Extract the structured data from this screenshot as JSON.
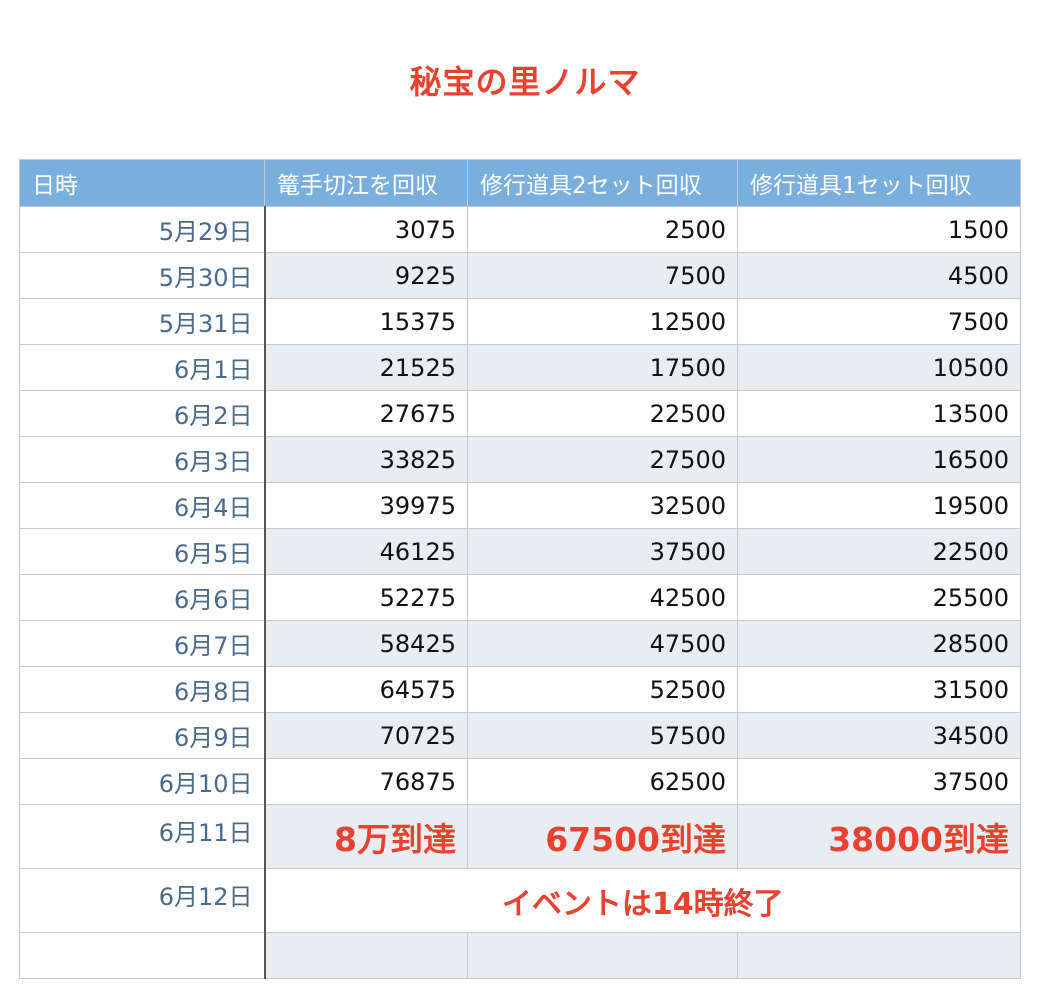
{
  "title": "秘宝の里ノルマ",
  "headers": [
    "日時",
    "篭手切江を回収",
    "修行道具2セット回収",
    "修行道具1セット回収"
  ],
  "rows": [
    {
      "date": "5月29日",
      "v1": "3075",
      "v2": "2500",
      "v3": "1500"
    },
    {
      "date": "5月30日",
      "v1": "9225",
      "v2": "7500",
      "v3": "4500"
    },
    {
      "date": "5月31日",
      "v1": "15375",
      "v2": "12500",
      "v3": "7500"
    },
    {
      "date": "6月1日",
      "v1": "21525",
      "v2": "17500",
      "v3": "10500"
    },
    {
      "date": "6月2日",
      "v1": "27675",
      "v2": "22500",
      "v3": "13500"
    },
    {
      "date": "6月3日",
      "v1": "33825",
      "v2": "27500",
      "v3": "16500"
    },
    {
      "date": "6月4日",
      "v1": "39975",
      "v2": "32500",
      "v3": "19500"
    },
    {
      "date": "6月5日",
      "v1": "46125",
      "v2": "37500",
      "v3": "22500"
    },
    {
      "date": "6月6日",
      "v1": "52275",
      "v2": "42500",
      "v3": "25500"
    },
    {
      "date": "6月7日",
      "v1": "58425",
      "v2": "47500",
      "v3": "28500"
    },
    {
      "date": "6月8日",
      "v1": "64575",
      "v2": "52500",
      "v3": "31500"
    },
    {
      "date": "6月9日",
      "v1": "70725",
      "v2": "57500",
      "v3": "34500"
    },
    {
      "date": "6月10日",
      "v1": "76875",
      "v2": "62500",
      "v3": "37500"
    }
  ],
  "milestone": {
    "date": "6月11日",
    "v1": "8万到達",
    "v2": "67500到達",
    "v3": "38000到達"
  },
  "event_row": {
    "date": "6月12日",
    "text": "イベントは14時終了"
  },
  "colors": {
    "header_bg": "#7aaedc",
    "accent_red": "#e8412f",
    "date_text": "#4a6a8c",
    "alt_row": "#e8edf1"
  }
}
